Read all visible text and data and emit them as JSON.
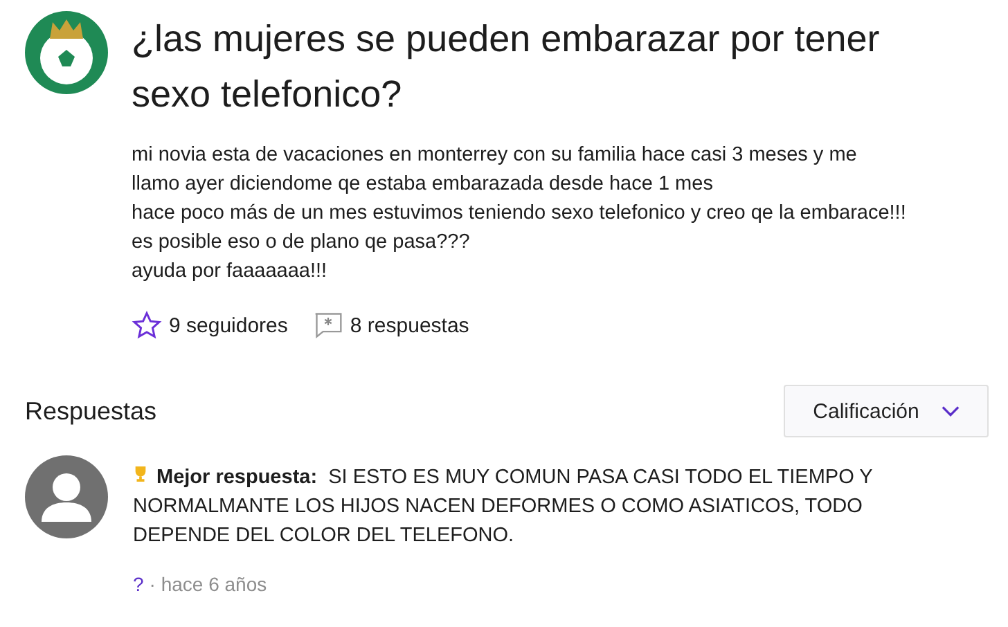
{
  "question": {
    "title": "¿las mujeres se pueden embarazar por tener sexo telefonico?",
    "body": [
      "mi novia esta de vacaciones en monterrey con su familia hace casi 3 meses y me llamo ayer diciendome qe estaba embarazada desde hace 1 mes",
      "hace poco más de un mes estuvimos teniendo sexo telefonico y creo qe la embarace!!!",
      "es posible eso o de plano qe pasa???",
      "ayuda por faaaaaaa!!!"
    ],
    "followers": "9 seguidores",
    "answers_count": "8 respuestas"
  },
  "answers_section": {
    "heading": "Respuestas",
    "sort": "Calificación"
  },
  "answers": [
    {
      "best_label": "Mejor respuesta:",
      "text": "SI ESTO ES MUY COMUN PASA CASI TODO EL TIEMPO Y NORMALMANTE LOS HIJOS NACEN DEFORMES O COMO ASIATICOS, TODO DEPENDE DEL COLOR DEL TELEFONO.",
      "author": "?",
      "meta": "· hace 6 años"
    }
  ]
}
